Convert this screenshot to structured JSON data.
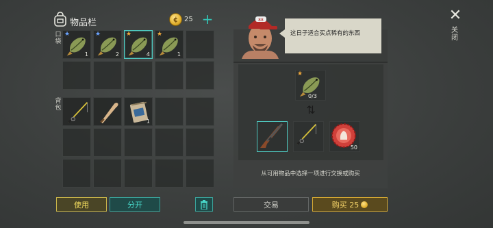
{
  "inventory": {
    "title": "物品栏",
    "coins": "25",
    "pocket_label": "口袋",
    "backpack_label": "背包",
    "pocket": [
      {
        "type": "fish",
        "star": "blue",
        "count": "1",
        "selected": false
      },
      {
        "type": "fish",
        "star": "blue",
        "count": "2",
        "selected": false
      },
      {
        "type": "fish",
        "star": "gold",
        "count": "4",
        "selected": true
      },
      {
        "type": "fish",
        "star": "gold",
        "count": "1",
        "selected": false
      },
      {
        "type": "empty"
      },
      {
        "type": "empty"
      },
      {
        "type": "empty"
      },
      {
        "type": "empty"
      },
      {
        "type": "empty"
      },
      {
        "type": "empty"
      }
    ],
    "backpack": [
      {
        "type": "rod",
        "count": ""
      },
      {
        "type": "bat",
        "count": ""
      },
      {
        "type": "bag",
        "count": "1"
      },
      {
        "type": "empty"
      },
      {
        "type": "empty"
      },
      {
        "type": "empty"
      },
      {
        "type": "empty"
      },
      {
        "type": "empty"
      },
      {
        "type": "empty"
      },
      {
        "type": "empty"
      },
      {
        "type": "empty"
      },
      {
        "type": "empty"
      },
      {
        "type": "empty"
      },
      {
        "type": "empty"
      },
      {
        "type": "empty"
      }
    ]
  },
  "npc": {
    "speech": "这日子适合买点稀有的东西",
    "cap_text": "88"
  },
  "trade": {
    "request_count": "0/3",
    "offers": [
      {
        "type": "rifle",
        "count": "",
        "selected": true
      },
      {
        "type": "rod",
        "count": "",
        "selected": false
      },
      {
        "type": "bottlecap",
        "count": "50",
        "selected": false
      }
    ],
    "hint": "从可用物品中选择一项进行交换或购买"
  },
  "buttons": {
    "use": "使用",
    "split": "分开",
    "trade": "交易",
    "buy": "购买 25"
  },
  "close": {
    "label": "关闭"
  },
  "colors": {
    "accent_teal": "#4fc9c0",
    "accent_gold": "#d7aa33",
    "star_blue": "#6aa3ff",
    "star_gold": "#f2a93b"
  }
}
